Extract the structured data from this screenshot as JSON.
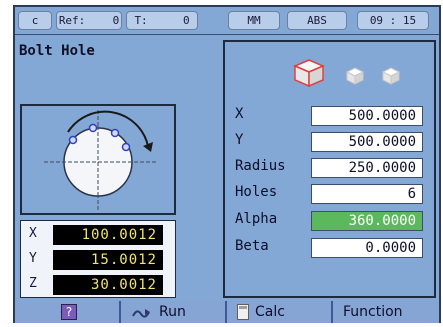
{
  "status_bar": {
    "mode": "c",
    "ref_label": "Ref:",
    "ref_value": "0",
    "tool_label": "T:",
    "tool_value": "0",
    "units": "MM",
    "position_mode": "ABS",
    "time": "09 : 15"
  },
  "page": {
    "title": "Bolt Hole"
  },
  "dro": [
    {
      "axis": "X",
      "value": "100.0012"
    },
    {
      "axis": "Y",
      "value": "15.0012"
    },
    {
      "axis": "Z",
      "value": "30.0012"
    }
  ],
  "params": [
    {
      "label": "X",
      "value": "500.0000"
    },
    {
      "label": "Y",
      "value": "500.0000"
    },
    {
      "label": "Radius",
      "value": "250.0000"
    },
    {
      "label": "Holes",
      "value": "6"
    },
    {
      "label": "Alpha",
      "value": "360.0000"
    },
    {
      "label": "Beta",
      "value": "0.0000"
    }
  ],
  "softkeys": {
    "help": "?",
    "run": "Run",
    "calc": "Calc",
    "function": "Function"
  },
  "colors": {
    "screen": "#84a8d6",
    "dro_digits": "#f2e66a",
    "active_field": "#5cb85c",
    "softkey_bar": "#4a78c0"
  },
  "icons": [
    "help-icon",
    "run-icon",
    "calculator-icon",
    "view-iso-icon",
    "view-cube-icon",
    "view-cube-small-icon"
  ]
}
